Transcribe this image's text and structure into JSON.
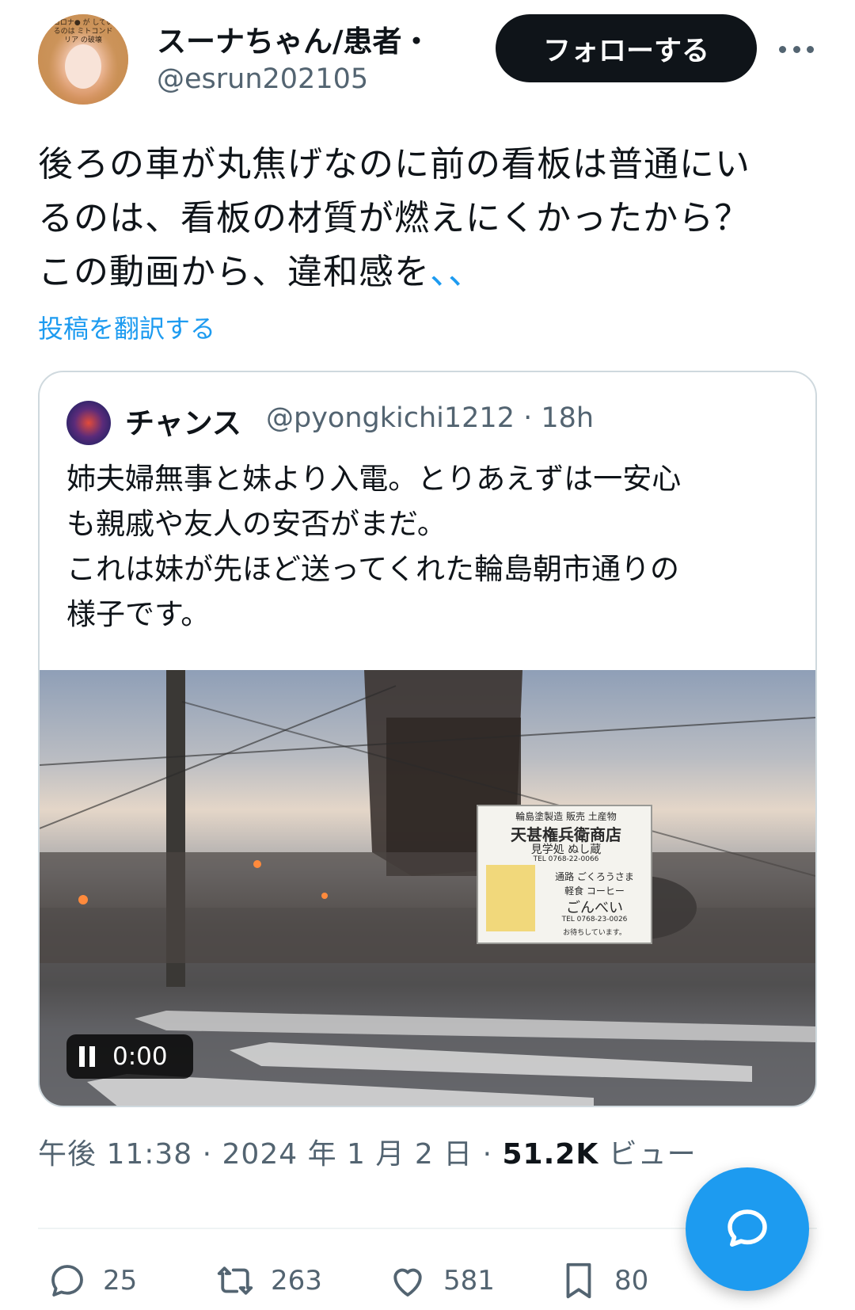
{
  "tweet": {
    "author": {
      "display_name": "スーナちゃん/患者・",
      "handle": "@esrun202105",
      "avatar_caption": "コロナ● が しているのは ミトコンドリア の破壊"
    },
    "follow_label": "フォローする",
    "more_icon": "more-horizontal-icon",
    "text_lines": [
      "後ろの車が丸焦げなのに前の看板は普通にい",
      "るのは、看板の材質が燃えにくかったから？",
      "この動画から、違和感を"
    ],
    "text_link": "、、",
    "translate_label": "投稿を翻訳する",
    "quote": {
      "name": "チャンス",
      "meta": "@pyongkichi1212 · 18h",
      "lines": [
        "姉夫婦無事と妹より入電。とりあえずは一安心",
        "も親戚や友人の安否がまだ。",
        "これは妹が先ほど送ってくれた輪島朝市通りの",
        "様子です。"
      ],
      "video": {
        "time": "0:00",
        "sign": {
          "row1": "輪島塗製造 販売 土産物",
          "row2": "天甚権兵衛商店",
          "row3": "見学処 ぬし蔵",
          "row4": "TEL 0768-22-0066",
          "row5": "通路 ごくろうさま",
          "row6": "軽食 コーヒー",
          "row7": "ごんべい",
          "row8": "TEL 0768-23-0026",
          "row9": "お待ちしています。"
        }
      }
    },
    "timestamp": {
      "text": "午後 11:38 · 2024 年 1 月 2 日 · ",
      "views": "51.2K",
      "views_label": " ビュー"
    },
    "actions": {
      "replies": "25",
      "reposts": "263",
      "likes": "581",
      "bookmarks": "80"
    },
    "colors": {
      "accent": "#1d9bf0",
      "text": "#0f1419",
      "muted": "#536471"
    }
  }
}
